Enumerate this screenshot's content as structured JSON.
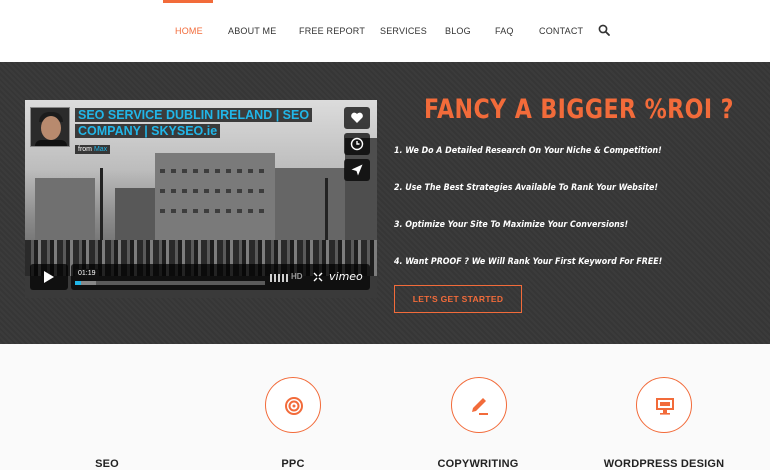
{
  "nav": {
    "items": [
      {
        "label": "HOME",
        "active": true
      },
      {
        "label": "ABOUT ME",
        "active": false
      },
      {
        "label": "FREE REPORT",
        "active": false
      },
      {
        "label": "SERVICES",
        "active": false
      },
      {
        "label": "BLOG",
        "active": false
      },
      {
        "label": "FAQ",
        "active": false
      },
      {
        "label": "CONTACT",
        "active": false
      }
    ],
    "search_icon": "search-icon"
  },
  "video": {
    "title_line1": "SEO SERVICE DUBLIN IRELAND | SEO",
    "title_line2": "COMPANY | SKYSEO.ie",
    "from_label": "from",
    "from_user": "Max",
    "time": "01:19",
    "hd_label": "HD",
    "brand": "vimeo",
    "progress": 0.03,
    "buttons": [
      "heart-icon",
      "clock-icon",
      "share-icon"
    ]
  },
  "hero": {
    "heading": "FANCY A BIGGER %ROI ?",
    "bullets": [
      "1. We Do A Detailed Research On Your Niche & Competition!",
      "2. Use The Best Strategies Available To Rank Your Website!",
      "3. Optimize Your Site To Maximize Your Conversions!",
      "4. Want PROOF ? We Will Rank Your First Keyword For FREE!"
    ],
    "cta": "LET'S GET STARTED"
  },
  "services": {
    "items": [
      {
        "title": "SEO",
        "icon": "target-icon"
      },
      {
        "title": "PPC",
        "icon": "target-icon"
      },
      {
        "title": "COPYWRITING",
        "icon": "pencil-icon"
      },
      {
        "title": "WORDPRESS DESIGN",
        "icon": "monitor-icon"
      }
    ]
  },
  "colors": {
    "accent": "#f26b3a",
    "hero_bg": "#363636",
    "vimeo_blue": "#21b6e8"
  }
}
